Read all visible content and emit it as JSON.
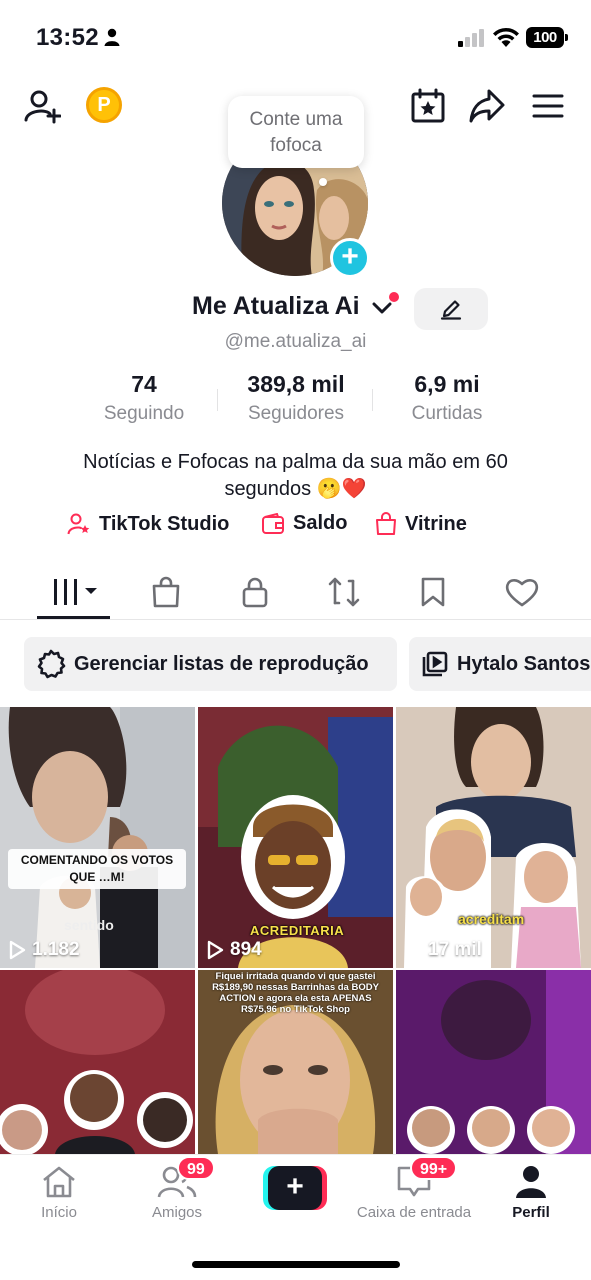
{
  "status_bar": {
    "time": "13:52",
    "battery": "100"
  },
  "top_bar": {
    "coin_label": "P"
  },
  "tooltip": {
    "text": "Conte uma fofoca"
  },
  "profile": {
    "name": "Me Atualiza Ai",
    "username": "@me.atualiza_ai",
    "stats": [
      {
        "value": "74",
        "label": "Seguindo"
      },
      {
        "value": "389,8 mil",
        "label": "Seguidores"
      },
      {
        "value": "6,9 mi",
        "label": "Curtidas"
      }
    ],
    "bio": "Notícias e Fofocas na palma da sua mão em 60 segundos 🫢❤️"
  },
  "links": [
    {
      "label": "TikTok Studio",
      "icon": "person-star-icon"
    },
    {
      "label": "Saldo",
      "icon": "wallet-icon"
    },
    {
      "label": "Vitrine",
      "icon": "shopping-bag-icon"
    }
  ],
  "tabs": [
    {
      "icon": "grid-icon",
      "active": true
    },
    {
      "icon": "shopping-bag-icon"
    },
    {
      "icon": "lock-icon"
    },
    {
      "icon": "repost-icon"
    },
    {
      "icon": "bookmark-icon"
    },
    {
      "icon": "heart-icon"
    }
  ],
  "chips": [
    {
      "label": "Gerenciar listas de reprodução",
      "icon": "gear-icon"
    },
    {
      "label": "Hytalo Santos",
      "icon": "playlist-icon"
    }
  ],
  "videos": [
    {
      "views": "1.182",
      "caption": "COMENTANDO OS VOTOS QUE …M!",
      "overlay": "sentido"
    },
    {
      "views": "894",
      "caption": "ACREDITARIA"
    },
    {
      "views": "17 mil",
      "caption": "acreditam"
    },
    {
      "views": ""
    },
    {
      "views": "",
      "caption": "Fiquei irritada quando vi que gastei R$189,90 nessas Barrinhas da BODY ACTION e agora ela esta APENAS R$75,96 no TikTok Shop"
    },
    {
      "views": ""
    }
  ],
  "bottom_nav": {
    "home": "Início",
    "friends": "Amigos",
    "friends_badge": "99",
    "inbox": "Caixa de entrada",
    "inbox_badge": "99+",
    "profile": "Perfil",
    "create": "+"
  },
  "colors": {
    "accent": "#FE2C55",
    "cyan": "#25F4EE",
    "add_button": "#20C4E0",
    "text": "#161823",
    "muted": "#8A8B91"
  }
}
